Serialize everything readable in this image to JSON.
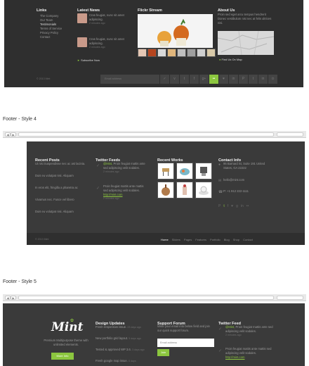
{
  "s3": {
    "links_title": "Links",
    "links": [
      "The Company",
      "Our Team",
      "Testimonials",
      "Terms of Service",
      "Privacy Policy",
      "Contact"
    ],
    "news_title": "Latest News",
    "news": [
      {
        "text": "Cras feugiat, nunc sit amet adipiscing.",
        "date": "2 minutes ago"
      },
      {
        "text": "Cras feugiat, nunc sit amet adipiscing.",
        "date": "2 minutes ago"
      }
    ],
    "subscribe": "Subscribe Now",
    "flickr_title": "Flickr Stream",
    "about_title": "About Us",
    "about_text": "Proin sed eget arcu tempus hendrerit Donec vestibulum nisi nec at felis ultrices nisi.",
    "map_link": "Find Us On Map",
    "copyright": "© 2013 Mint",
    "email_placeholder": "Email address",
    "social": [
      "✓",
      "v",
      "t",
      "f",
      "g+",
      "••",
      "♥",
      "in",
      "P",
      "t",
      "in",
      "⊙"
    ]
  },
  "cap4": "Footer - Style 4",
  "s4": {
    "posts_title": "Recent Posts",
    "posts": [
      "Ut nisi Suspendisse nec ac ast lacinia.",
      "Duis eu volutpat nisi. Aliquam",
      "In eros elit, fringilla a pharetra ac",
      "Vivamus nec. Fusce vel libero",
      "Duis eu volutpat nisi. Aliquam"
    ],
    "twitter_title": "Twitter Feeds",
    "tweets": [
      {
        "handle": "@Mint,",
        "text": "Proin feugiat mattis ante sed adipiscing velit sodales.",
        "time": "2 minutes ago"
      },
      {
        "handle": "",
        "text": "Proin feugiat mattis ante mattis sed adipiscing velit sodales.",
        "link": "http://mint.com",
        "time": "2 minutes ago"
      }
    ],
    "works_title": "Recent Works",
    "contact_title": "Contact Info",
    "contact": [
      "95 Barnard St, Suite 191 United States, GA 22222",
      "hello@mint.com",
      "P: +1 912 222-1111"
    ],
    "copyright": "© 2013 Mint",
    "nav": [
      "Home",
      "Sliders",
      "Pages",
      "Features",
      "Portfolio",
      "Blog",
      "Shop",
      "Contact"
    ]
  },
  "cap5": "Footer - Style 5",
  "s5": {
    "logo": "Mint",
    "tagline": "Premium Multipurpose theme with unlimited elements.",
    "more_btn": "More Info",
    "updates_title": "Design Updates",
    "updates": [
      {
        "text": "Fresh responsive issue.",
        "time": "23 days ago"
      },
      {
        "text": "New portfolio grid layout.",
        "time": "5 days ago"
      },
      {
        "text": "Tested & approved WP 3.6.",
        "time": "3 days ago"
      },
      {
        "text": "Fresh google map issue.",
        "time": "6 days"
      }
    ],
    "forum_title": "Support Forum",
    "forum_text": "Write your email into below field and join our quick support forum.",
    "email_placeholder": "Email address",
    "join_btn": "Join",
    "feed_title": "Twitter Feed",
    "tweets": [
      {
        "handle": "@Mint,",
        "text": "Proin feugiat mattis ante sed adipiscing velit sodales.",
        "time": "2 minutes ago"
      },
      {
        "handle": "",
        "text": "Proin feugiat mattis ante mattis sed adipiscing velit sodales.",
        "link": "http://mint.com"
      }
    ]
  }
}
